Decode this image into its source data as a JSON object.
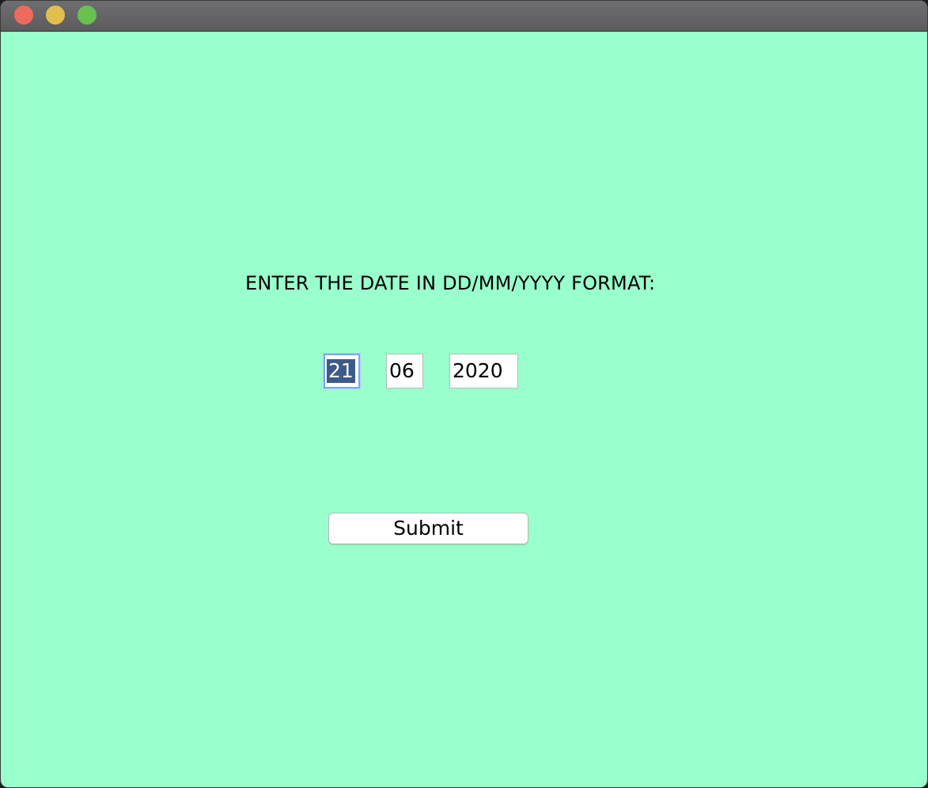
{
  "window": {
    "background": "#99ffcc",
    "controls": {
      "close_color": "#ee6a5e",
      "minimize_color": "#e2be4f",
      "maximize_color": "#69c14f"
    }
  },
  "form": {
    "prompt": "ENTER THE DATE IN DD/MM/YYYY FORMAT:",
    "day_value": "21",
    "month_value": "06",
    "year_value": "2020",
    "submit_label": "Submit"
  }
}
